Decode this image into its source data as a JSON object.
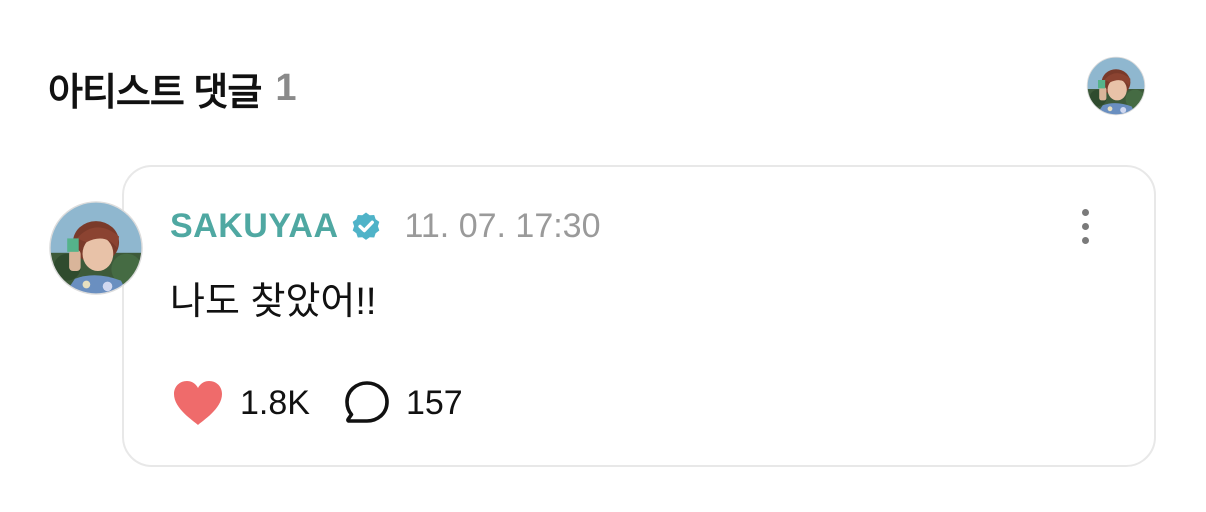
{
  "section": {
    "title": "아티스트 댓글",
    "count": "1"
  },
  "comment": {
    "author": "SAKUYAA",
    "verified": true,
    "timestamp": "11. 07. 17:30",
    "text": "나도 찾았어!!",
    "likes": "1.8K",
    "replies": "157"
  },
  "colors": {
    "author": "#4fa8a2",
    "verified_badge": "#4fb3c8",
    "like_heart": "#ef6b6b",
    "timestamp": "#9a9a9a",
    "card_border": "#e8e8e8"
  },
  "icons": {
    "verified": "verified-badge-icon",
    "more": "more-vertical-icon",
    "like": "heart-icon",
    "reply": "speech-bubble-icon"
  }
}
